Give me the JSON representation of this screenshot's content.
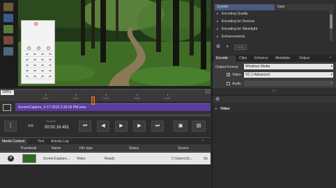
{
  "preview": {
    "zoom": "100%",
    "ticks": [
      "0:00",
      "1:00",
      "2:00",
      "3:00",
      "4:00"
    ]
  },
  "timeline": {
    "clip_name": "ScreenCapture_4-17-2015 3.39.03 PM.xesc"
  },
  "transport": {
    "ab_label": "A/B",
    "position_label": "Position",
    "position_value": "00:01:16.491"
  },
  "media_panel": {
    "tabs": [
      "Media Content",
      "Text",
      "Activity Log"
    ],
    "columns": [
      "Thumbnail",
      "Name",
      "File type",
      "Status",
      "Source"
    ],
    "rows": [
      {
        "name": "ScreenCapture...",
        "file_type": "Video",
        "status": "Ready",
        "source": "C:\\Users\\Jo...",
        "extra": "So"
      }
    ]
  },
  "presets": {
    "tabs": [
      "System",
      "User"
    ],
    "items": [
      "Encoding Quality",
      "Encoding for Devices",
      "Encoding for Silverlight",
      "Enhancements"
    ],
    "apply_label": "Apply"
  },
  "encode": {
    "tabs": [
      "Encode",
      "Clips",
      "Enhance",
      "Metadata",
      "Output"
    ],
    "output_format_label": "Output Format",
    "output_format_value": "Windows Media",
    "video_label": "Video",
    "video_value": "VC-1 Advanced",
    "audio_label": "Audio",
    "section_label": "Video"
  },
  "colors": {
    "clip": "#5a3c9e",
    "system_tab": "#4a5a7a",
    "playhead": "#f08000"
  }
}
